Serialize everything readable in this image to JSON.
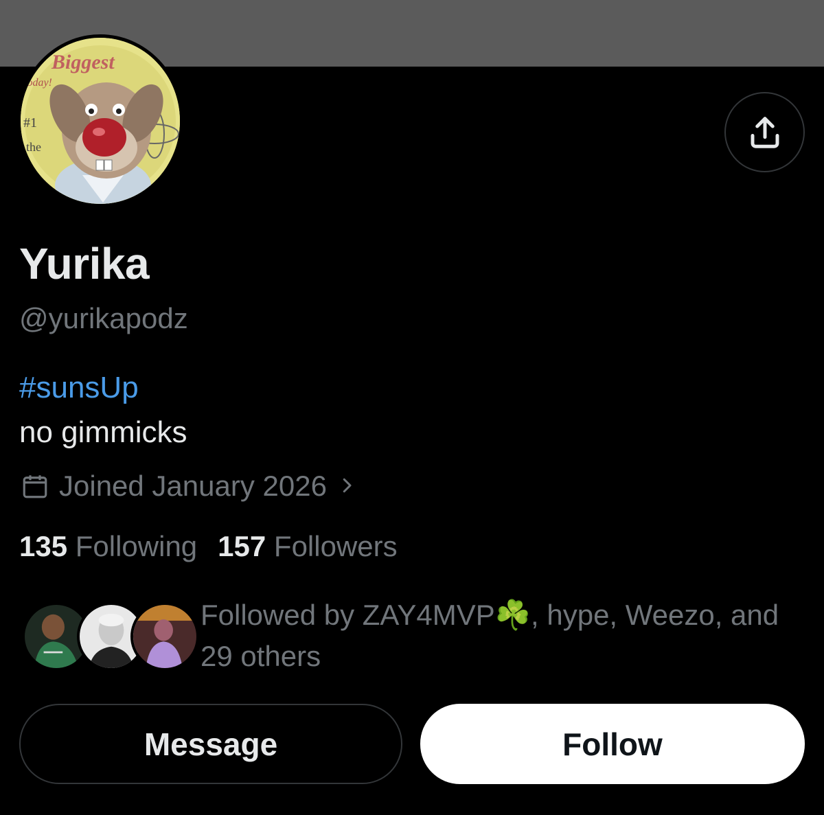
{
  "profile": {
    "name": "Yurika",
    "handle": "@yurikapodz",
    "bio_hashtag": "#sunsUp",
    "bio_text": "no gimmicks",
    "joined": "Joined January 2026",
    "avatar_text": {
      "top": "Biggest",
      "sub": "today!",
      "rank": "#1",
      "the": "the"
    }
  },
  "counts": {
    "following_num": "135",
    "following_label": "Following",
    "followers_num": "157",
    "followers_label": "Followers"
  },
  "followed_by": {
    "text_line1": "Followed by ZAY4MVP☘️, hype, Weezo, and",
    "text_line2": "29 others"
  },
  "actions": {
    "message_label": "Message",
    "follow_label": "Follow"
  },
  "icons": {
    "share": "share-upload-icon",
    "calendar": "calendar-icon",
    "chevron": "chevron-right-icon"
  },
  "colors": {
    "background": "#000000",
    "banner": "#5b5b5b",
    "link": "#4a9be8",
    "muted": "#71767b",
    "text": "#e7e9ea",
    "follow_bg": "#ffffff"
  }
}
